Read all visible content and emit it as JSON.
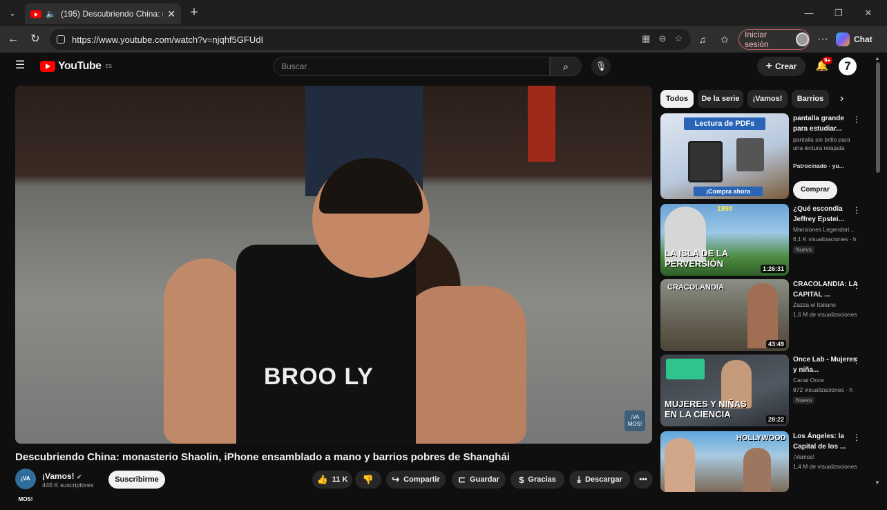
{
  "browser": {
    "tab_title": "(195) Descubriendo China: mo",
    "tab_close": "✕",
    "new_tab": "+",
    "url": "https://www.youtube.com/watch?v=njqhf5GFUdI",
    "signin_label": "Iniciar sesión",
    "chat_label": "Chat",
    "window_controls": [
      "—",
      "❐",
      "✕"
    ]
  },
  "youtube": {
    "logo_text": "YouTube",
    "logo_region": "ES",
    "search_placeholder": "Buscar",
    "create_label": "Crear",
    "notif_count": "9+",
    "video": {
      "title": "Descubriendo China: monasterio Shaolin, iPhone ensamblado a mano y barrios pobres de Shanghái",
      "jersey_text": "BROO LY",
      "watermark": "¡VA MOS!"
    },
    "channel": {
      "name": "¡Vamos!",
      "subscribers": "446 K suscriptores",
      "avatar_text": "¡VA MOS!",
      "subscribe_label": "Suscribirme"
    },
    "actions": {
      "likes": "11 K",
      "share": "Compartir",
      "save": "Guardar",
      "thanks": "Gracias",
      "download": "Descargar",
      "more": "•••"
    },
    "chips": [
      "Todos",
      "De la serie",
      "¡Vamos!",
      "Barrios"
    ],
    "recommendations": [
      {
        "title": "pantalla grande para estudiar...",
        "meta1": "pantalla sin brillo para una lectura relajada",
        "meta2": "Patrocinado · yu...",
        "thumb_text": "Lectura de PDFs",
        "thumb_sub": "¡Compra ahora",
        "button": "Comprar"
      },
      {
        "title": "¿Qué escondía Jeffrey Epstei...",
        "meta1": "Mansiones Legendari...",
        "meta2": "6,1 K visualizaciones · h",
        "badge": "Nuevo",
        "duration": "1:26:31",
        "thumb_text": "LA ISLA DE LA PERVERSIÓN",
        "thumb_year": "1998"
      },
      {
        "title": "CRACOLANDIA: LA CAPITAL ...",
        "meta1": "Zazza el Italiano",
        "meta2": "1,6 M de visualizaciones",
        "duration": "43:49",
        "thumb_text": "CRACOLANDIA"
      },
      {
        "title": "Once Lab - Mujeres y niña...",
        "meta1": "Canal Once",
        "meta2": "872 visualizaciones · h",
        "badge": "Nuevo",
        "duration": "28:22",
        "thumb_text": "MUJERES Y NIÑAS EN LA CIENCIA"
      },
      {
        "title": "Los Ángeles: la Capital de los ...",
        "meta1": "¡Vamos!",
        "meta2": "1,4 M de visualizaciones",
        "thumb_text": "HOLLYWOOD"
      }
    ]
  }
}
